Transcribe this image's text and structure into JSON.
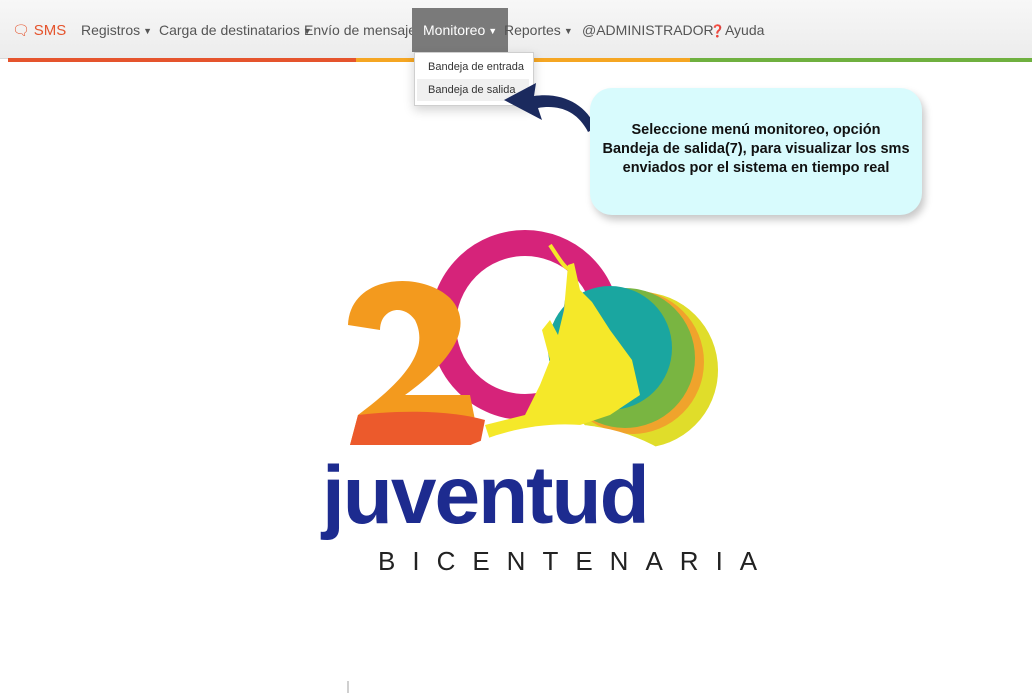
{
  "nav": {
    "brand": "SMS",
    "registros": "Registros",
    "carga": "Carga de destinatarios",
    "envio": "Envío de mensajes",
    "monitoreo": "Monitoreo",
    "reportes": "Reportes",
    "admin": "@ADMINISTRADOR",
    "ayuda": "Ayuda",
    "dropdown": {
      "items": [
        "Bandeja de entrada",
        "Bandeja de salida"
      ]
    }
  },
  "callout": {
    "line1": "Seleccione menú monitoreo, opción",
    "line2": "Bandeja de salida(7), para visualizar los sms",
    "line3": "enviados por el sistema en tiempo real"
  },
  "logo": {
    "number": "200",
    "word": "juventud",
    "subtitle": "BICENTENARIA"
  },
  "colors": {
    "brand": "#e5542d",
    "active_menu": "#7a7a7a",
    "stripe": [
      "#e5542d",
      "#f5a623",
      "#6fb03f"
    ],
    "callout_bg": "#d8fbfd",
    "arrow": "#1b2a5e"
  },
  "icons": {
    "brand": "chat-bubbles-icon",
    "ayuda": "question-circle-icon",
    "caret": "caret-down-icon"
  }
}
